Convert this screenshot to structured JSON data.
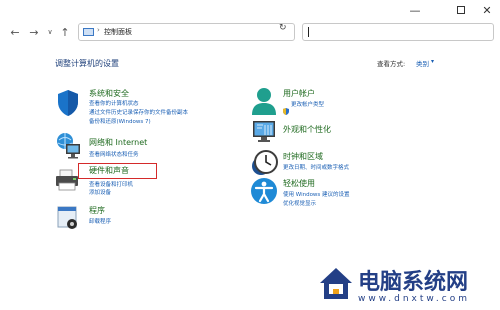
{
  "window": {
    "minimize_glyph": "—",
    "close_glyph": "✕"
  },
  "nav": {
    "back_glyph": "←",
    "forward_glyph": "→",
    "dropdown_glyph": "∨",
    "up_glyph": "↑"
  },
  "address": {
    "separator": "›",
    "path": "控制面板",
    "dropdown_glyph": "∨",
    "refresh_glyph": "↻"
  },
  "search": {
    "value": ""
  },
  "page": {
    "title": "调整计算机的设置",
    "view_by_label": "查看方式:",
    "view_by_value": "类别",
    "view_by_dropdown": "▾"
  },
  "categories": {
    "system_security": {
      "title": "系统和安全",
      "links": [
        "查看你的计算机状态",
        "通过文件历史记录保存你的文件备份副本",
        "备份和还原(Windows 7)"
      ]
    },
    "network": {
      "title": "网络和 Internet",
      "links": [
        "查看网络状态和任务"
      ]
    },
    "hardware_sound": {
      "title": "硬件和声音",
      "links": [
        "查看设备和打印机",
        "添加设备"
      ]
    },
    "programs": {
      "title": "程序",
      "links": [
        "卸载程序"
      ]
    },
    "user_accounts": {
      "title": "用户帐户",
      "links": [
        "更改帐户类型"
      ]
    },
    "appearance": {
      "title": "外观和个性化",
      "links": []
    },
    "clock_region": {
      "title": "时钟和区域",
      "links": [
        "更改日期、时间或数字格式"
      ]
    },
    "ease_of_access": {
      "title": "轻松使用",
      "links": [
        "使用 Windows 建议的设置",
        "优化视觉显示"
      ]
    }
  },
  "watermark": {
    "title": "电脑系统网",
    "url": "www.dnxtw.com"
  },
  "colors": {
    "category_title": "#1f6a1f",
    "link": "#1a5fb4",
    "highlight_box": "#d42a2a",
    "watermark": "#233f86"
  }
}
